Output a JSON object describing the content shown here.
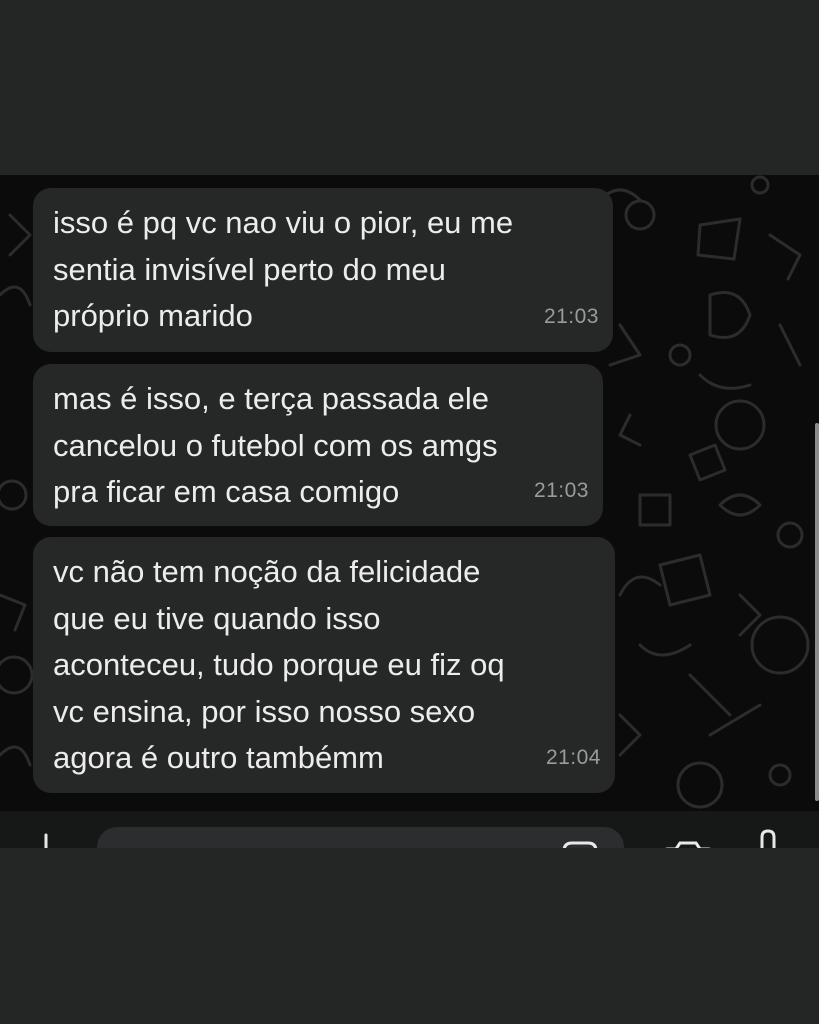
{
  "messages": [
    {
      "text": "isso é pq vc nao viu o pior, eu me\nsentia invisível perto do meu\npróprio marido",
      "time": "21:03"
    },
    {
      "text": "mas é isso, e terça passada ele\ncancelou o futebol com os amgs\npra ficar em casa comigo",
      "time": "21:03"
    },
    {
      "text": "vc não tem noção da felicidade\nque eu tive quando isso\naconteceu, tudo porque eu fiz oq\nvc ensina, por isso nosso sexo\nagora é outro tambémm",
      "time": "21:04"
    }
  ],
  "colors": {
    "outer_background": "#242626",
    "chat_background": "#0b0b0b",
    "bubble_background": "#262727",
    "message_text": "#ececec",
    "timestamp_text": "#9a9b9c"
  },
  "icons": [
    "plus-icon",
    "sticker-icon",
    "camera-icon",
    "microphone-icon"
  ]
}
